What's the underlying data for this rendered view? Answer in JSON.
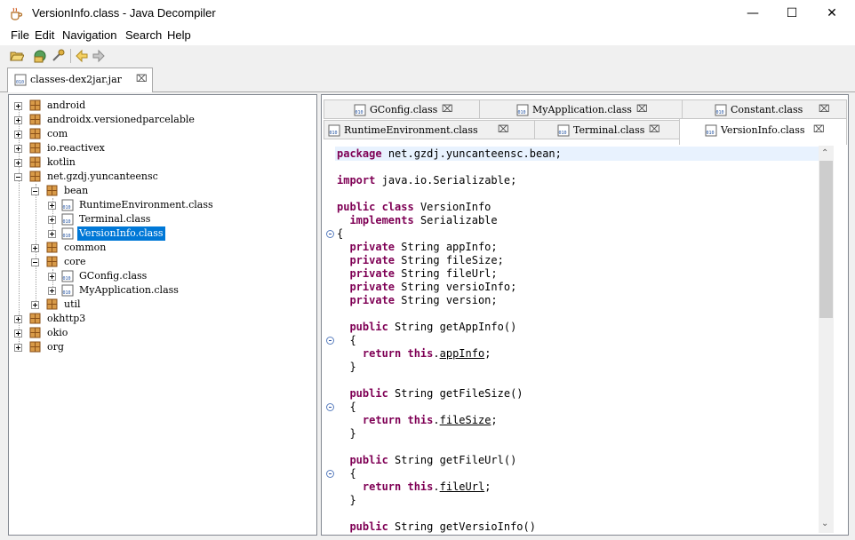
{
  "window": {
    "title": "VersionInfo.class - Java Decompiler"
  },
  "menu": [
    "File",
    "Edit",
    "Navigation",
    "Search",
    "Help"
  ],
  "jar_tab": {
    "label": "classes-dex2jar.jar"
  },
  "tree": {
    "root_items": [
      "android",
      "androidx.versionedparcelable",
      "com",
      "io.reactivex",
      "kotlin",
      "net.gzdj.yuncanteensc"
    ],
    "bean": "bean",
    "bean_children": [
      "RuntimeEnvironment.class",
      "Terminal.class",
      "VersionInfo.class"
    ],
    "common": "common",
    "core": "core",
    "core_children": [
      "GConfig.class",
      "MyApplication.class"
    ],
    "util": "util",
    "tail_items": [
      "okhttp3",
      "okio",
      "org"
    ]
  },
  "class_tabs": {
    "row1": [
      "GConfig.class",
      "MyApplication.class",
      "Constant.class"
    ],
    "row2": [
      "RuntimeEnvironment.class",
      "Terminal.class",
      "VersionInfo.class"
    ]
  },
  "code": {
    "package": "net.gzdj.yuncanteensc.bean;",
    "import": "java.io.Serializable;",
    "class_decl": "VersionInfo",
    "implements_iface": "Serializable",
    "fields": [
      "appInfo;",
      "fileSize;",
      "fileUrl;",
      "versioInfo;",
      "version;"
    ],
    "methods": [
      {
        "sig": "getAppInfo()",
        "field": "appInfo"
      },
      {
        "sig": "getFileSize()",
        "field": "fileSize"
      },
      {
        "sig": "getFileUrl()",
        "field": "fileUrl"
      },
      {
        "sig": "getVersioInfo()"
      }
    ]
  },
  "colors": {
    "keyword": "#7f0055",
    "selection": "#0078d7",
    "current_line": "#e8f2fe"
  }
}
